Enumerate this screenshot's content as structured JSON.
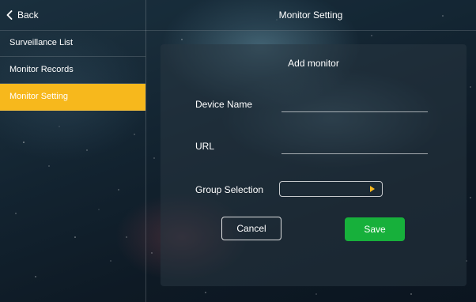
{
  "header": {
    "back_label": "Back",
    "title": "Monitor Setting"
  },
  "sidebar": {
    "items": [
      {
        "label": "Surveillance List",
        "active": false
      },
      {
        "label": "Monitor Records",
        "active": false
      },
      {
        "label": "Monitor Setting",
        "active": true
      }
    ]
  },
  "form": {
    "title": "Add monitor",
    "device_name": {
      "label": "Device Name",
      "value": ""
    },
    "url": {
      "label": "URL",
      "value": ""
    },
    "group": {
      "label": "Group Selection",
      "value": ""
    },
    "cancel_label": "Cancel",
    "save_label": "Save"
  },
  "colors": {
    "accent": "#f7b81c",
    "save": "#17b03b",
    "dropdown_arrow": "#f7b81c"
  },
  "icons": [
    "chevron-left-icon",
    "triangle-right-icon"
  ]
}
